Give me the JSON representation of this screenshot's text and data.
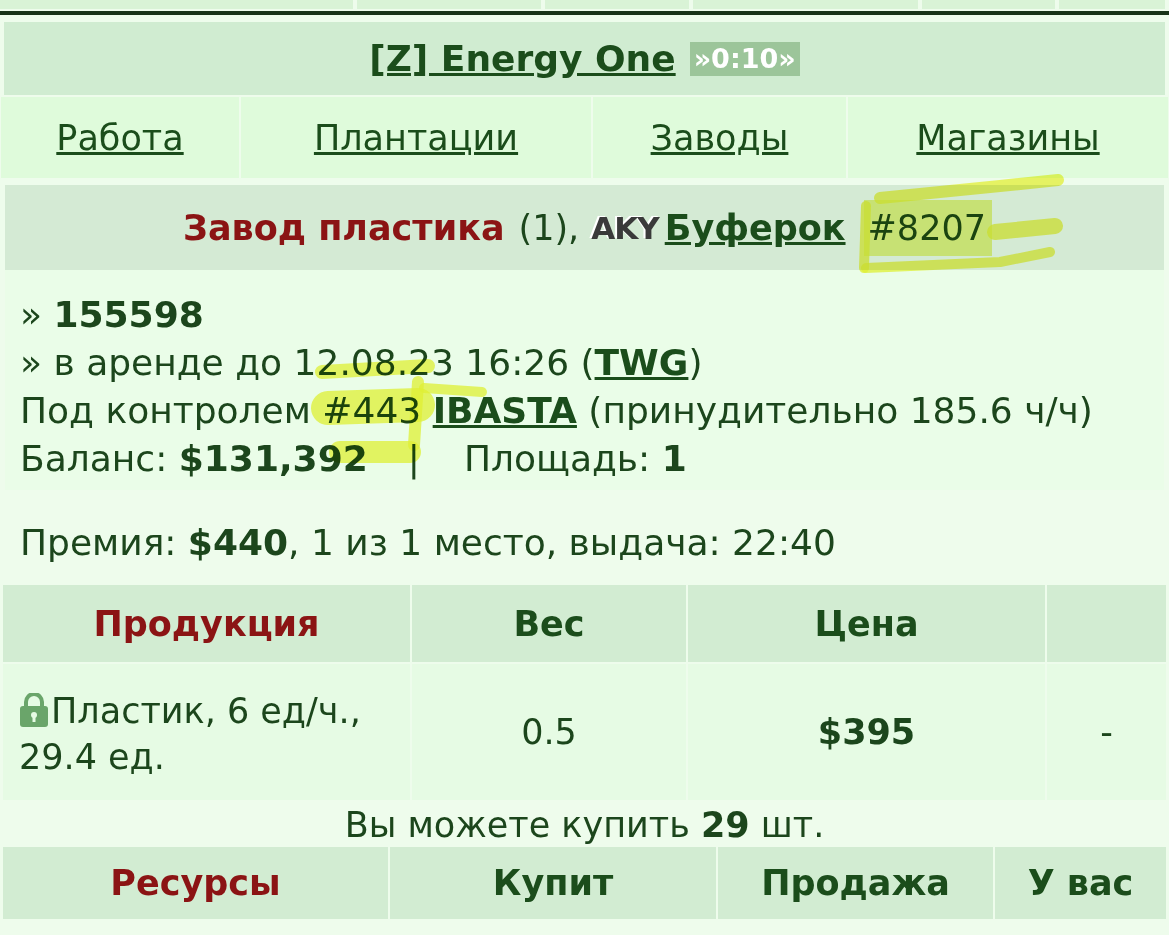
{
  "header": {
    "title": "[Z] Energy One",
    "timer": "»0:10»"
  },
  "nav": [
    "Работа",
    "Плантации",
    "Заводы",
    "Магазины"
  ],
  "factory": {
    "type_name": "Завод пластика",
    "count": "(1),",
    "clan_logo": "AKY",
    "owner": "Буферок",
    "id": "#8207"
  },
  "info": {
    "number_line": "» **155598**",
    "rent": {
      "before": "» в аренде до 12.08.23 16:26 (",
      "link": "TWG",
      "after": ")"
    },
    "control": {
      "before": "Под контролем #443 ",
      "link": "IBASTA",
      "after": " (принудительно 185.6 ч/ч)"
    },
    "balance": "Баланс: **$131,392**",
    "separator": "|",
    "area": "Площадь: **1**"
  },
  "premium": "Премия: **$440**, 1 из 1 место, выдача: 22:40",
  "products": {
    "columns": [
      "Продукция",
      "Вес",
      "Цена"
    ],
    "rows": [
      {
        "locked": true,
        "name": "Пластик, 6 ед/ч., 29.4 ед.",
        "weight": "0.5",
        "price": "$395",
        "column_4": "-"
      }
    ]
  },
  "can_buy": "Вы можете купить **29** шт.",
  "resources": {
    "columns": [
      "Ресурсы",
      "Купит",
      "Продажа",
      "У вас"
    ]
  }
}
